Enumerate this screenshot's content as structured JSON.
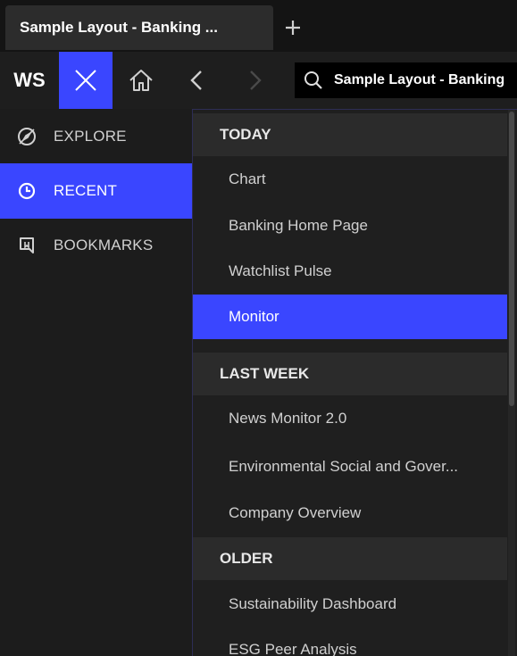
{
  "tab": {
    "title": "Sample Layout - Banking ...",
    "new_tab_icon": "plus-icon"
  },
  "toolbar": {
    "brand": "WS",
    "close_icon": "close-icon",
    "home_icon": "home-icon",
    "back_icon": "chevron-left-icon",
    "forward_icon": "chevron-right-icon",
    "search_text": "Sample Layout - Banking",
    "accent": "#3a46ff"
  },
  "leftnav": {
    "items": [
      {
        "label": "EXPLORE",
        "icon": "compass-icon",
        "active": false
      },
      {
        "label": "RECENT",
        "icon": "clock-icon",
        "active": true
      },
      {
        "label": "BOOKMARKS",
        "icon": "bookmark-icon",
        "active": false
      }
    ]
  },
  "recent": {
    "sections": [
      {
        "title": "TODAY",
        "items": [
          "Chart",
          "Banking Home Page",
          "Watchlist Pulse",
          "Monitor"
        ]
      },
      {
        "title": "LAST WEEK",
        "items": [
          "News Monitor 2.0",
          "Environmental Social and Gover...",
          "Company Overview"
        ]
      },
      {
        "title": "OLDER",
        "items": [
          "Sustainability Dashboard",
          "ESG Peer Analysis"
        ]
      }
    ],
    "active_item": "Monitor"
  }
}
